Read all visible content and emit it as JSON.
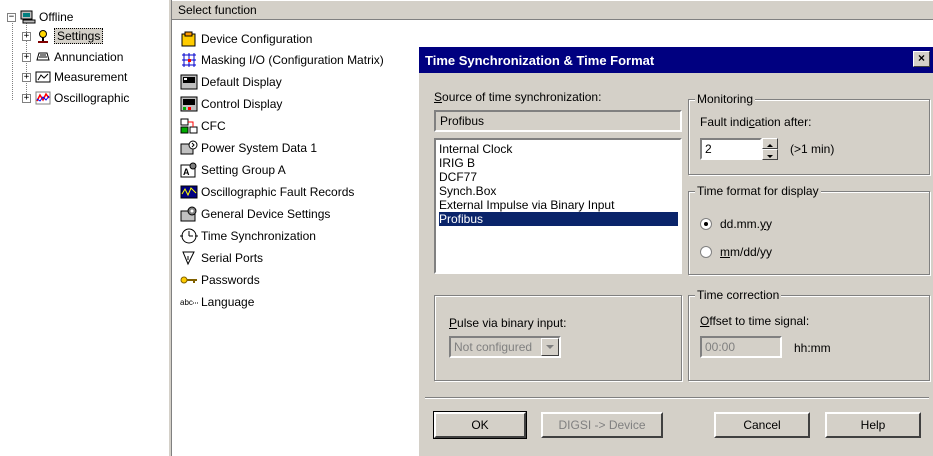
{
  "tree": {
    "root": "Offline",
    "items": [
      {
        "label": "Settings",
        "icon": "settings-icon"
      },
      {
        "label": "Annunciation",
        "icon": "annunciation-icon"
      },
      {
        "label": "Measurement",
        "icon": "measurement-icon"
      },
      {
        "label": "Oscillographic",
        "icon": "oscillographic-icon"
      }
    ]
  },
  "list": {
    "header": "Select function",
    "items": [
      {
        "label": "Device Configuration",
        "icon": "device-config-icon"
      },
      {
        "label": "Masking I/O (Configuration Matrix)",
        "icon": "matrix-icon"
      },
      {
        "label": "Default Display",
        "icon": "display-icon"
      },
      {
        "label": "Control Display",
        "icon": "control-display-icon"
      },
      {
        "label": "CFC",
        "icon": "cfc-icon"
      },
      {
        "label": "Power System Data 1",
        "icon": "power-system-icon"
      },
      {
        "label": "Setting Group A",
        "icon": "setting-group-icon"
      },
      {
        "label": "Oscillographic Fault Records",
        "icon": "fault-records-icon"
      },
      {
        "label": "General Device Settings",
        "icon": "general-settings-icon"
      },
      {
        "label": "Time Synchronization",
        "icon": "time-sync-icon"
      },
      {
        "label": "Serial Ports",
        "icon": "serial-ports-icon"
      },
      {
        "label": "Passwords",
        "icon": "key-icon"
      },
      {
        "label": "Language",
        "icon": "language-icon"
      }
    ]
  },
  "dialog": {
    "title": "Time Synchronization & Time Format",
    "close": "×",
    "source": {
      "label": "Source of time synchronization:",
      "value": "Profibus",
      "options": [
        "Internal Clock",
        "IRIG B",
        "DCF77",
        "Synch.Box",
        "External Impulse via Binary Input",
        "Profibus"
      ],
      "selected_index": 5
    },
    "monitoring": {
      "title": "Monitoring",
      "fault_label": "Fault indication after:",
      "fault_value": "2",
      "fault_unit": "(>1 min)"
    },
    "time_format": {
      "title": "Time format for display",
      "options": [
        "dd.mm.yy",
        "mm/dd/yy"
      ],
      "selected": "dd.mm.yy"
    },
    "pulse": {
      "label": "Pulse via binary input:",
      "value": "Not configured"
    },
    "time_correction": {
      "title": "Time correction",
      "offset_label": "Offset to time signal:",
      "offset_value": "00:00",
      "unit": "hh:mm"
    },
    "buttons": {
      "ok": "OK",
      "digsi": "DIGSI -> Device",
      "cancel": "Cancel",
      "help": "Help"
    }
  }
}
